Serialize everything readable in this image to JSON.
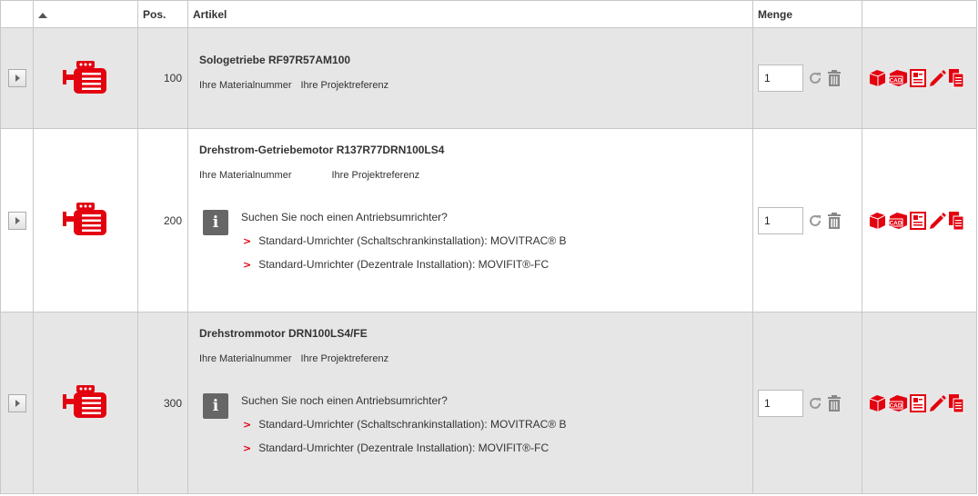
{
  "header": {
    "pos_label": "Pos.",
    "article_label": "Artikel",
    "quantity_label": "Menge"
  },
  "colors": {
    "brand_red": "#e3000f",
    "row_gray": "#e6e6e7",
    "icon_gray": "#888888"
  },
  "rows": [
    {
      "pos": "100",
      "title": "Sologetriebe RF97R57AM100",
      "material_label": "Ihre Materialnummer",
      "project_label": "Ihre Projektreferenz",
      "quantity": "1"
    },
    {
      "pos": "200",
      "title": "Drehstrom-Getriebemotor R137R77DRN100LS4",
      "material_label": "Ihre Materialnummer",
      "project_label": "Ihre Projektreferenz",
      "quantity": "1",
      "hint": {
        "icon_text": "i",
        "title": "Suchen Sie noch einen Antriebsumrichter?",
        "links": [
          "Standard-Umrichter (Schaltschrankinstallation): MOVITRAC® B",
          "Standard-Umrichter (Dezentrale Installation): MOVIFIT®-FC"
        ]
      }
    },
    {
      "pos": "300",
      "title": "Drehstrommotor DRN100LS4/FE",
      "material_label": "Ihre Materialnummer",
      "project_label": "Ihre Projektreferenz",
      "quantity": "1",
      "hint": {
        "icon_text": "i",
        "title": "Suchen Sie noch einen Antriebsumrichter?",
        "links": [
          "Standard-Umrichter (Schaltschrankinstallation): MOVITRAC® B",
          "Standard-Umrichter (Dezentrale Installation): MOVIFIT®-FC"
        ]
      }
    }
  ],
  "icons": {
    "motor": "motor-icon",
    "refresh": "refresh-icon",
    "trash": "trash-icon",
    "catalog": "catalog-icon",
    "cad": "cad-icon",
    "cad_label": "CAD",
    "datasheet": "datasheet-icon",
    "edit": "edit-icon",
    "documents": "documents-icon"
  }
}
